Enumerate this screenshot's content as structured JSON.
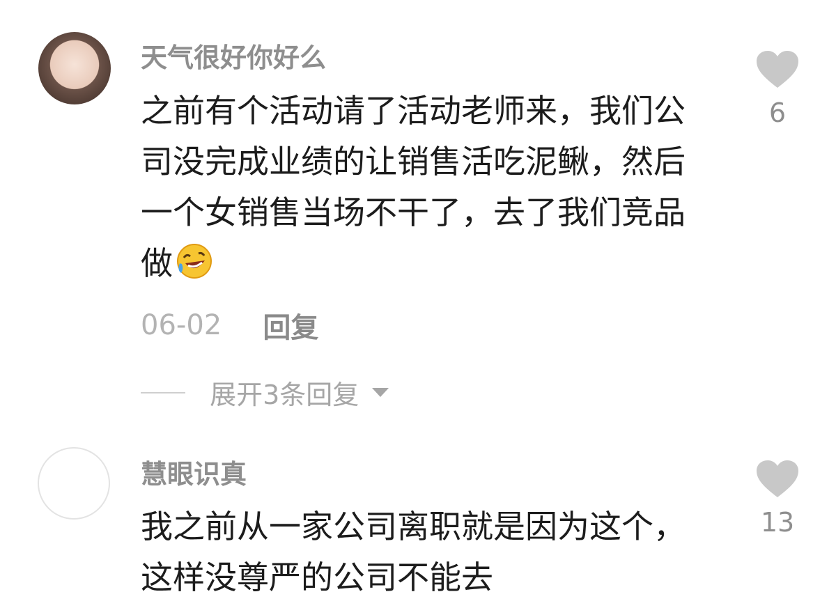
{
  "comments": [
    {
      "username": "天气很好你好么",
      "text": "之前有个活动请了活动老师来，我们公司没完成业绩的让销售活吃泥鳅，然后一个女销售当场不干了，去了我们竞品做",
      "emoji": "rolling-on-floor-laughing",
      "likes": "6",
      "date": "06-02",
      "reply_label": "回复",
      "expand_label": "展开3条回复"
    },
    {
      "username": "慧眼识真",
      "text": "我之前从一家公司离职就是因为这个，这样没尊严的公司不能去",
      "likes": "13"
    }
  ],
  "colors": {
    "username": "#8e8e8e",
    "text": "#1c1c1c",
    "meta": "#b3b3b3",
    "heart": "#c8c8c8"
  }
}
